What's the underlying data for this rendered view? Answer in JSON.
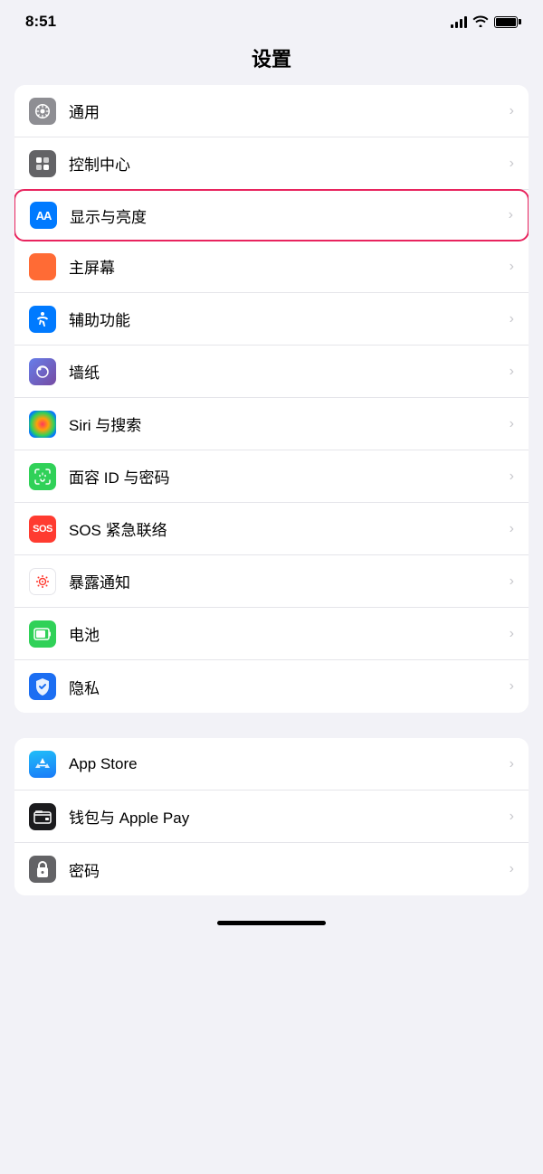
{
  "statusBar": {
    "time": "8:51",
    "signal": "signal",
    "wifi": "wifi",
    "battery": "battery"
  },
  "pageTitle": "设置",
  "groups": [
    {
      "id": "group1",
      "items": [
        {
          "id": "general",
          "label": "通用",
          "icon": "gear",
          "iconBg": "bg-gray"
        },
        {
          "id": "control-center",
          "label": "控制中心",
          "icon": "toggles",
          "iconBg": "bg-gray2"
        },
        {
          "id": "display",
          "label": "显示与亮度",
          "icon": "aa",
          "iconBg": "icon-aa",
          "highlighted": true
        },
        {
          "id": "home-screen",
          "label": "主屏幕",
          "icon": "grid",
          "iconBg": "icon-grid"
        },
        {
          "id": "accessibility",
          "label": "辅助功能",
          "icon": "accessibility",
          "iconBg": "bg-blue"
        },
        {
          "id": "wallpaper",
          "label": "墙纸",
          "icon": "wallpaper",
          "iconBg": "bg-gray"
        },
        {
          "id": "siri",
          "label": "Siri 与搜索",
          "icon": "siri",
          "iconBg": "icon-siri"
        },
        {
          "id": "faceid",
          "label": "面容 ID 与密码",
          "icon": "faceid",
          "iconBg": "icon-faceid"
        },
        {
          "id": "sos",
          "label": "SOS 紧急联络",
          "icon": "sos",
          "iconBg": "icon-sos"
        },
        {
          "id": "exposure",
          "label": "暴露通知",
          "icon": "exposure",
          "iconBg": "icon-exposure"
        },
        {
          "id": "battery",
          "label": "电池",
          "icon": "battery",
          "iconBg": "bg-green3"
        },
        {
          "id": "privacy",
          "label": "隐私",
          "icon": "privacy",
          "iconBg": "icon-privacy"
        }
      ]
    },
    {
      "id": "group2",
      "items": [
        {
          "id": "appstore",
          "label": "App Store",
          "icon": "appstore",
          "iconBg": "icon-appstore"
        },
        {
          "id": "wallet",
          "label": "钱包与 Apple Pay",
          "icon": "wallet",
          "iconBg": "icon-wallet"
        },
        {
          "id": "passwords",
          "label": "密码",
          "icon": "password",
          "iconBg": "icon-password"
        }
      ]
    }
  ]
}
